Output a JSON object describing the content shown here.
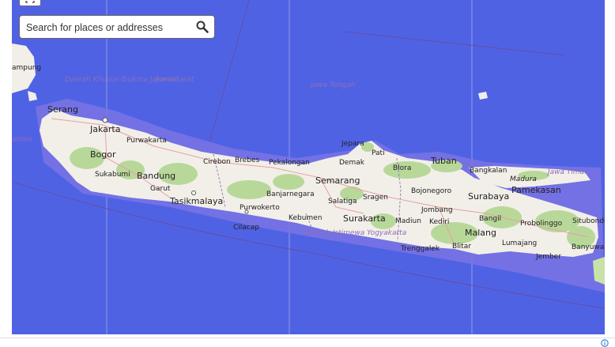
{
  "search": {
    "placeholder": "Search for places or addresses",
    "icon": "search-icon"
  },
  "controls": {
    "fullscreen_icon": "expand-icon",
    "info_icon": "info-icon"
  },
  "colors": {
    "water": "#5062e4",
    "land": "#f2efe9",
    "forest": "#b8d89a",
    "boundary": "#9a7fb5",
    "road": "#e8a0a0"
  },
  "map": {
    "provinces": [
      "Daerah Khusus Ibukota Jakarta",
      "Jawa Barat",
      "Jawa Tengah",
      "Daerah Istimewa Yogyakarta",
      "Jawa Timur"
    ],
    "cities": {
      "serang": "Serang",
      "jakarta": "Jakarta",
      "bogor": "Bogor",
      "purwakarta": "Purwakarta",
      "sukabumi": "Sukabumi",
      "bandung": "Bandung",
      "garut": "Garut",
      "tasikmalaya": "Tasikmalaya",
      "cirebon": "Cirebon",
      "brebes": "Brebes",
      "pekalongan": "Pekalongan",
      "purwokerto": "Purwokerto",
      "cilacap": "Cilacap",
      "banjarnegara": "Banjarnegara",
      "kebumen": "Kebumen",
      "semarang": "Semarang",
      "salatiga": "Salatiga",
      "sragen": "Sragen",
      "surakarta": "Surakarta",
      "demak": "Demak",
      "jepara": "Jepara",
      "pati": "Pati",
      "blora": "Blora",
      "tuban": "Tuban",
      "bojonegoro": "Bojonegoro",
      "jombang": "Jombang",
      "madiun": "Madiun",
      "kediri": "Kediri",
      "blitar": "Blitar",
      "trenggalek": "Trenggalek",
      "malang": "Malang",
      "surabaya": "Surabaya",
      "bangkalan": "Bangkalan",
      "madura": "Madura",
      "pamekasan": "Pamekasan",
      "bangil": "Bangil",
      "probolinggo": "Probolinggo",
      "situbondo": "Situbondo",
      "lumajang": "Lumajang",
      "jember": "Jember",
      "banyuwangi": "Banyuwa",
      "lampung_edge": "ampung",
      "banten_edge": "anten"
    }
  }
}
